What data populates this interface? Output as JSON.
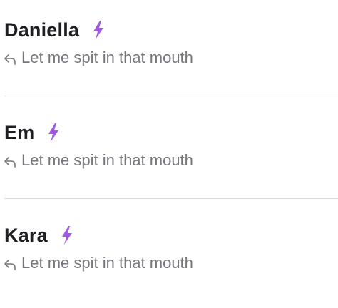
{
  "colors": {
    "name": "#1d1d22",
    "message": "#76767e",
    "bolt": "#a259e6",
    "divider": "#d9d9de"
  },
  "conversations": [
    {
      "name": "Daniella",
      "badge_icon": "lightning-bolt-icon",
      "reply_icon": "reply-arrow-icon",
      "last_message": "Let me spit in that mouth"
    },
    {
      "name": "Em",
      "badge_icon": "lightning-bolt-icon",
      "reply_icon": "reply-arrow-icon",
      "last_message": "Let me spit in that mouth"
    },
    {
      "name": "Kara",
      "badge_icon": "lightning-bolt-icon",
      "reply_icon": "reply-arrow-icon",
      "last_message": "Let me spit in that mouth"
    }
  ]
}
